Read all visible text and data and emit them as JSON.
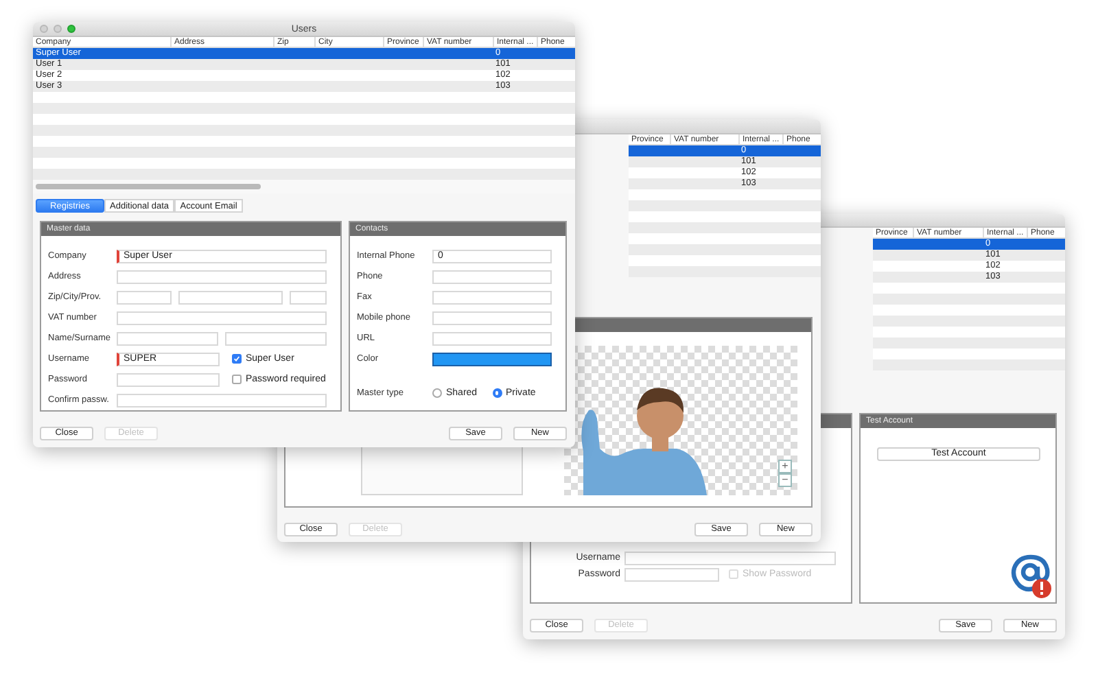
{
  "front_window": {
    "title": "Users",
    "table": {
      "columns": [
        "Company",
        "Address",
        "Zip",
        "City",
        "Province",
        "VAT number",
        "Internal ...",
        "Phone"
      ],
      "rows": [
        {
          "company": "Super User",
          "internal": "0",
          "selected": true
        },
        {
          "company": "User 1",
          "internal": "101",
          "selected": false
        },
        {
          "company": "User 2",
          "internal": "102",
          "selected": false
        },
        {
          "company": "User 3",
          "internal": "103",
          "selected": false
        }
      ]
    },
    "tabs": [
      {
        "label": "Registries",
        "selected": true
      },
      {
        "label": "Additional data",
        "selected": false
      },
      {
        "label": "Account Email",
        "selected": false
      }
    ],
    "master_data": {
      "title": "Master data",
      "rows": [
        {
          "label": "Company",
          "inputs": [
            {
              "value": "Super User",
              "required": true
            }
          ]
        },
        {
          "label": "Address",
          "inputs": [
            {
              "required": false
            }
          ]
        },
        {
          "label": "Zip/City/Prov.",
          "inputs": [
            {
              "required": false
            },
            {
              "required": false
            },
            {
              "required": false
            }
          ]
        },
        {
          "label": "VAT number",
          "inputs": [
            {
              "required": false
            }
          ]
        },
        {
          "label": "Name/Surname",
          "inputs": [
            {
              "required": false
            },
            {
              "required": false
            }
          ]
        },
        {
          "label": "Username",
          "inputs": [
            {
              "value": "SUPER",
              "required": true
            }
          ],
          "checkbox": {
            "label": "Super User",
            "checked": true,
            "disabled": false
          }
        },
        {
          "label": "Password",
          "inputs": [
            {
              "required": false
            }
          ],
          "checkbox": {
            "label": "Password required",
            "checked": false,
            "disabled": false
          }
        },
        {
          "label": "Confirm passw.",
          "inputs": [
            {
              "required": false
            }
          ]
        }
      ]
    },
    "contacts": {
      "title": "Contacts",
      "rows": [
        {
          "kind": "text",
          "label": "Internal Phone",
          "value": "0"
        },
        {
          "kind": "text",
          "label": "Phone"
        },
        {
          "kind": "text",
          "label": "Fax"
        },
        {
          "kind": "text",
          "label": "Mobile phone"
        },
        {
          "kind": "text",
          "label": "URL"
        },
        {
          "kind": "color",
          "label": "Color",
          "color": "#2196f3"
        },
        {
          "kind": "radio",
          "label": "Master type",
          "options": [
            {
              "label": "Shared",
              "selected": false
            },
            {
              "label": "Private",
              "selected": true
            }
          ]
        }
      ]
    },
    "buttons": [
      {
        "label": "Close",
        "disabled": false
      },
      {
        "label": "Delete",
        "disabled": true
      },
      {
        "label": "Save",
        "disabled": false
      },
      {
        "label": "New",
        "disabled": false
      }
    ]
  },
  "middle_window": {
    "table": {
      "columns": [
        "Province",
        "VAT number",
        "Internal ...",
        "Phone"
      ],
      "rows": [
        {
          "internal": "0",
          "selected": true
        },
        {
          "internal": "101",
          "selected": false
        },
        {
          "internal": "102",
          "selected": false
        },
        {
          "internal": "103",
          "selected": false
        }
      ]
    },
    "zoom_controls": [
      "+",
      "−"
    ],
    "buttons": [
      {
        "label": "Close",
        "disabled": false
      },
      {
        "label": "Delete",
        "disabled": true
      },
      {
        "label": "Save",
        "disabled": false
      },
      {
        "label": "New",
        "disabled": false
      }
    ]
  },
  "back_window": {
    "table": {
      "columns": [
        "Province",
        "VAT number",
        "Internal ...",
        "Phone"
      ],
      "rows": [
        {
          "internal": "0",
          "selected": true
        },
        {
          "internal": "101",
          "selected": false
        },
        {
          "internal": "102",
          "selected": false
        },
        {
          "internal": "103",
          "selected": false
        }
      ]
    },
    "connection": {
      "rows": [
        {
          "label": "Username"
        },
        {
          "label": "Password",
          "checkbox": {
            "label": "Show Password",
            "checked": false,
            "disabled": true
          }
        }
      ]
    },
    "test_panel": {
      "title": "Test Account",
      "button": "Test Account"
    },
    "buttons": [
      {
        "label": "Close",
        "disabled": false
      },
      {
        "label": "Delete",
        "disabled": true
      },
      {
        "label": "Save",
        "disabled": false
      },
      {
        "label": "New",
        "disabled": false
      }
    ]
  }
}
